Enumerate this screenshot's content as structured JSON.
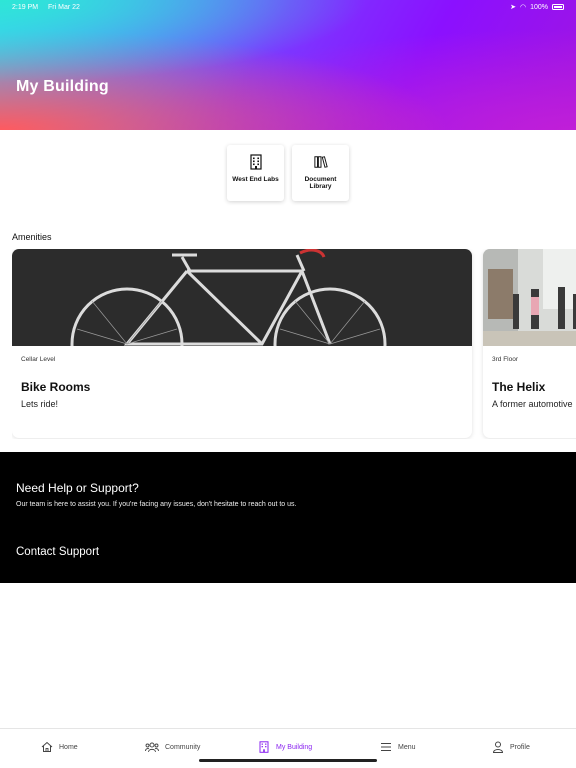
{
  "status_bar": {
    "time": "2:19 PM",
    "date": "Fri Mar 22",
    "battery": "100%"
  },
  "header": {
    "title": "My Building"
  },
  "quick_links": [
    {
      "label": "West End Labs",
      "icon": "building-icon"
    },
    {
      "label": "Document Library",
      "icon": "books-icon"
    }
  ],
  "amenities": {
    "title": "Amenities",
    "cards": [
      {
        "level": "Cellar Level",
        "name": "Bike Rooms",
        "description": "Lets ride!"
      },
      {
        "level": "3rd Floor",
        "name": "The Helix",
        "description": "A former automotive"
      }
    ]
  },
  "support": {
    "title": "Need Help or Support?",
    "description": "Our team is here to assist you. If you're facing any issues, don't hesitate to reach out to us.",
    "link": "Contact Support"
  },
  "tabbar": {
    "items": [
      {
        "label": "Home",
        "icon": "home-icon"
      },
      {
        "label": "Community",
        "icon": "community-icon"
      },
      {
        "label": "My Building",
        "icon": "building-icon"
      },
      {
        "label": "Menu",
        "icon": "menu-icon"
      },
      {
        "label": "Profile",
        "icon": "profile-icon"
      }
    ],
    "active": "My Building"
  },
  "colors": {
    "accent": "#8a25f0",
    "support_bg": "#000000"
  }
}
